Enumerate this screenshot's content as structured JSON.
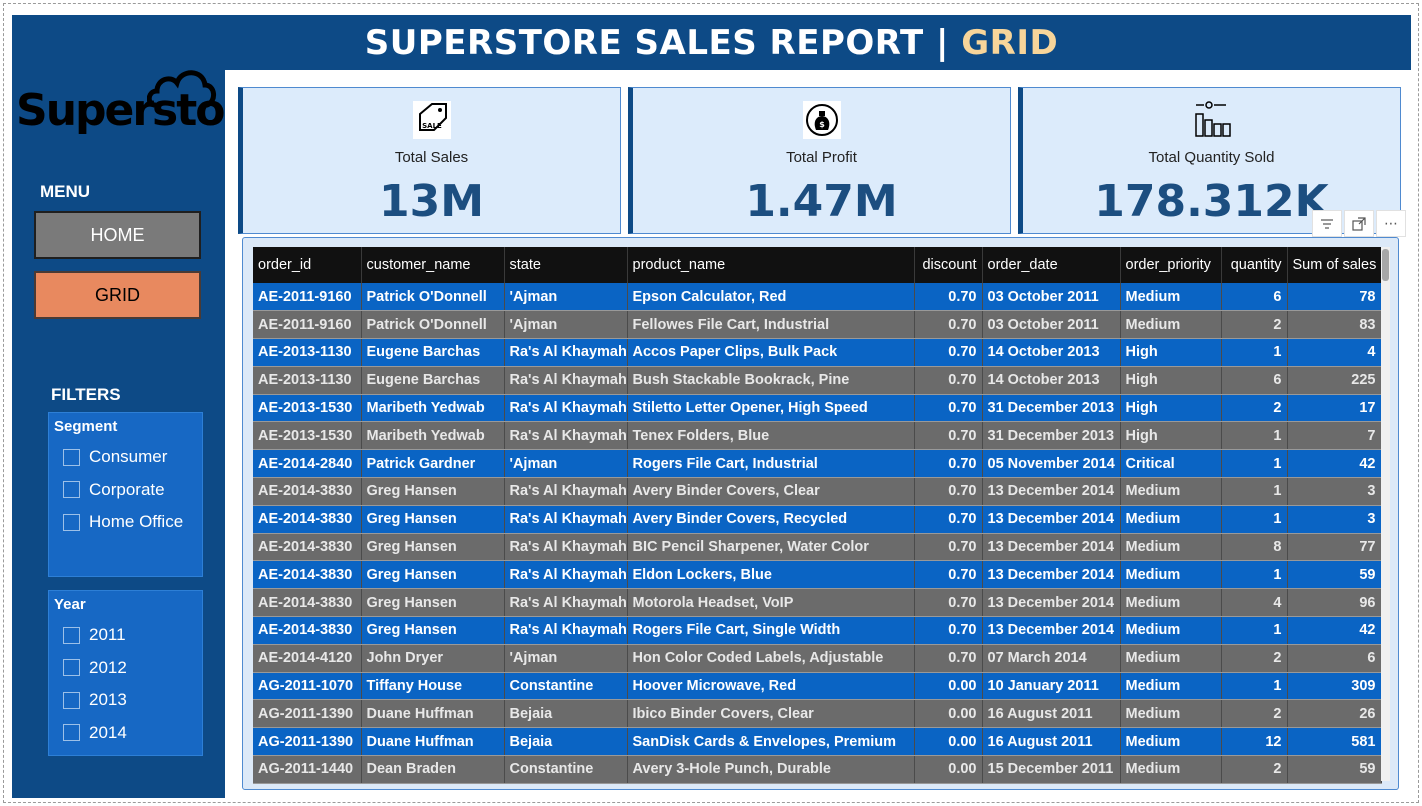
{
  "header": {
    "title_main": "SUPERSTORE SALES REPORT |",
    "title_accent": "GRID"
  },
  "logo": {
    "text": "Superstore"
  },
  "menu": {
    "title": "MENU",
    "home_label": "HOME",
    "grid_label": "GRID"
  },
  "filters": {
    "title": "FILTERS",
    "segment": {
      "title": "Segment",
      "items": [
        "Consumer",
        "Corporate",
        "Home Office"
      ]
    },
    "year": {
      "title": "Year",
      "items": [
        "2011",
        "2012",
        "2013",
        "2014"
      ]
    }
  },
  "kpis": [
    {
      "label": "Total Sales",
      "value": "13M",
      "icon": "sale-tag-icon"
    },
    {
      "label": "Total Profit",
      "value": "1.47M",
      "icon": "money-bag-icon"
    },
    {
      "label": "Total Quantity Sold",
      "value": "178.312K",
      "icon": "quantity-chart-icon"
    }
  ],
  "colors": {
    "background": "#0d4a86",
    "title_accent": "#f7d59a",
    "row_blue": "#0a64c4",
    "row_grey": "#6b6b6b",
    "grid_button": "#e8895f",
    "home_button": "#7a7a7a"
  },
  "table": {
    "columns": [
      "order_id",
      "customer_name",
      "state",
      "product_name",
      "discount",
      "order_date",
      "order_priority",
      "quantity",
      "Sum of sales"
    ],
    "rows": [
      [
        "AE-2011-9160",
        "Patrick O'Donnell",
        "'Ajman",
        "Epson Calculator, Red",
        "0.70",
        "03 October 2011",
        "Medium",
        "6",
        "78"
      ],
      [
        "AE-2011-9160",
        "Patrick O'Donnell",
        "'Ajman",
        "Fellowes File Cart, Industrial",
        "0.70",
        "03 October 2011",
        "Medium",
        "2",
        "83"
      ],
      [
        "AE-2013-1130",
        "Eugene Barchas",
        "Ra's Al Khaymah",
        "Accos Paper Clips, Bulk Pack",
        "0.70",
        "14 October 2013",
        "High",
        "1",
        "4"
      ],
      [
        "AE-2013-1130",
        "Eugene Barchas",
        "Ra's Al Khaymah",
        "Bush Stackable Bookrack, Pine",
        "0.70",
        "14 October 2013",
        "High",
        "6",
        "225"
      ],
      [
        "AE-2013-1530",
        "Maribeth Yedwab",
        "Ra's Al Khaymah",
        "Stiletto Letter Opener, High Speed",
        "0.70",
        "31 December 2013",
        "High",
        "2",
        "17"
      ],
      [
        "AE-2013-1530",
        "Maribeth Yedwab",
        "Ra's Al Khaymah",
        "Tenex Folders, Blue",
        "0.70",
        "31 December 2013",
        "High",
        "1",
        "7"
      ],
      [
        "AE-2014-2840",
        "Patrick Gardner",
        "'Ajman",
        "Rogers File Cart, Industrial",
        "0.70",
        "05 November 2014",
        "Critical",
        "1",
        "42"
      ],
      [
        "AE-2014-3830",
        "Greg Hansen",
        "Ra's Al Khaymah",
        "Avery Binder Covers, Clear",
        "0.70",
        "13 December 2014",
        "Medium",
        "1",
        "3"
      ],
      [
        "AE-2014-3830",
        "Greg Hansen",
        "Ra's Al Khaymah",
        "Avery Binder Covers, Recycled",
        "0.70",
        "13 December 2014",
        "Medium",
        "1",
        "3"
      ],
      [
        "AE-2014-3830",
        "Greg Hansen",
        "Ra's Al Khaymah",
        "BIC Pencil Sharpener, Water Color",
        "0.70",
        "13 December 2014",
        "Medium",
        "8",
        "77"
      ],
      [
        "AE-2014-3830",
        "Greg Hansen",
        "Ra's Al Khaymah",
        "Eldon Lockers, Blue",
        "0.70",
        "13 December 2014",
        "Medium",
        "1",
        "59"
      ],
      [
        "AE-2014-3830",
        "Greg Hansen",
        "Ra's Al Khaymah",
        "Motorola Headset, VoIP",
        "0.70",
        "13 December 2014",
        "Medium",
        "4",
        "96"
      ],
      [
        "AE-2014-3830",
        "Greg Hansen",
        "Ra's Al Khaymah",
        "Rogers File Cart, Single Width",
        "0.70",
        "13 December 2014",
        "Medium",
        "1",
        "42"
      ],
      [
        "AE-2014-4120",
        "John Dryer",
        "'Ajman",
        "Hon Color Coded Labels, Adjustable",
        "0.70",
        "07 March 2014",
        "Medium",
        "2",
        "6"
      ],
      [
        "AG-2011-1070",
        "Tiffany House",
        "Constantine",
        "Hoover Microwave, Red",
        "0.00",
        "10 January 2011",
        "Medium",
        "1",
        "309"
      ],
      [
        "AG-2011-1390",
        "Duane Huffman",
        "Bejaia",
        "Ibico Binder Covers, Clear",
        "0.00",
        "16 August 2011",
        "Medium",
        "2",
        "26"
      ],
      [
        "AG-2011-1390",
        "Duane Huffman",
        "Bejaia",
        "SanDisk Cards & Envelopes, Premium",
        "0.00",
        "16 August 2011",
        "Medium",
        "12",
        "581"
      ],
      [
        "AG-2011-1440",
        "Dean Braden",
        "Constantine",
        "Avery 3-Hole Punch, Durable",
        "0.00",
        "15 December 2011",
        "Medium",
        "2",
        "59"
      ]
    ]
  }
}
